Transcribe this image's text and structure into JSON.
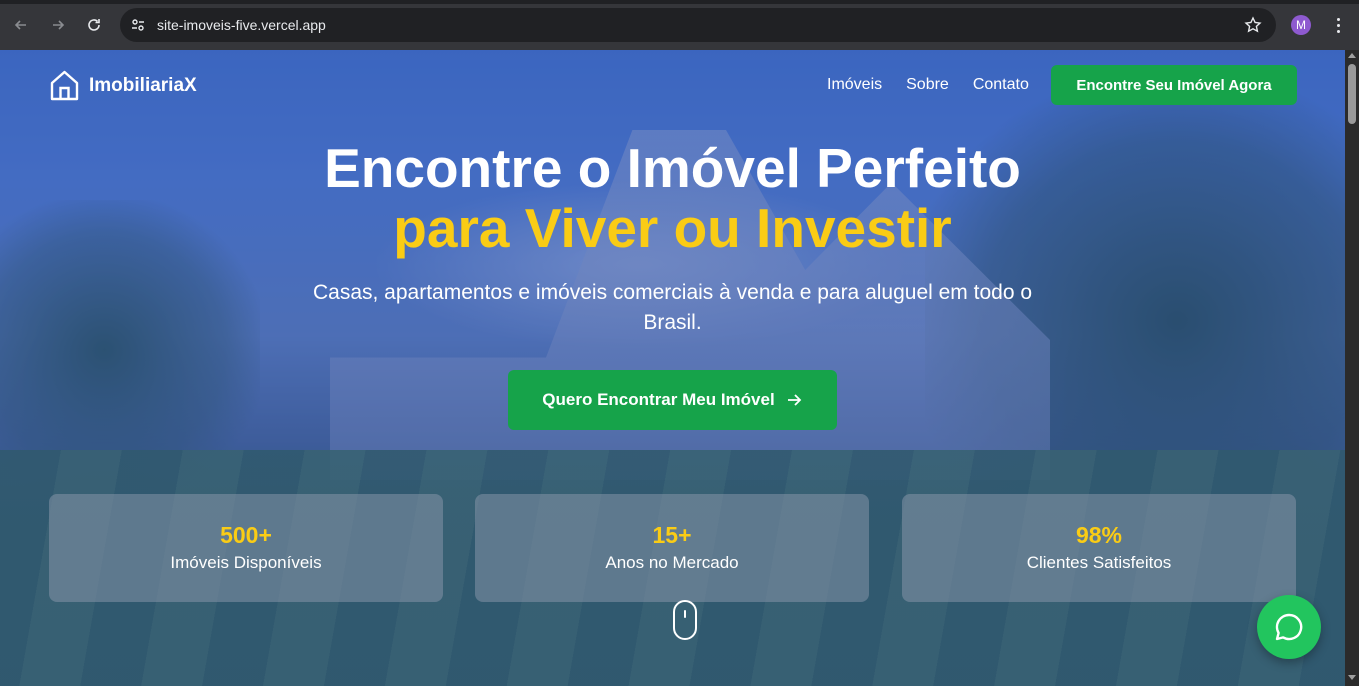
{
  "browser": {
    "url": "site-imoveis-five.vercel.app",
    "profile_initial": "M",
    "icons": [
      "back-icon",
      "forward-icon",
      "reload-icon",
      "site-settings-icon",
      "bookmark-star-icon",
      "menu-icon"
    ]
  },
  "navbar": {
    "brand": "ImobiliariaX",
    "links": [
      "Imóveis",
      "Sobre",
      "Contato"
    ],
    "cta": "Encontre Seu Imóvel Agora"
  },
  "hero": {
    "title_line1": "Encontre o Imóvel Perfeito",
    "title_line2": "para Viver ou Investir",
    "subtitle": "Casas, apartamentos e imóveis comerciais à venda e para aluguel em todo o Brasil.",
    "cta": "Quero Encontrar Meu Imóvel"
  },
  "stats": [
    {
      "value": "500+",
      "label": "Imóveis Disponíveis"
    },
    {
      "value": "15+",
      "label": "Anos no Mercado"
    },
    {
      "value": "98%",
      "label": "Clientes Satisfeitos"
    }
  ],
  "colors": {
    "accent_green": "#16a34a",
    "accent_yellow": "#facc15",
    "whatsapp_green": "#22c55e"
  }
}
